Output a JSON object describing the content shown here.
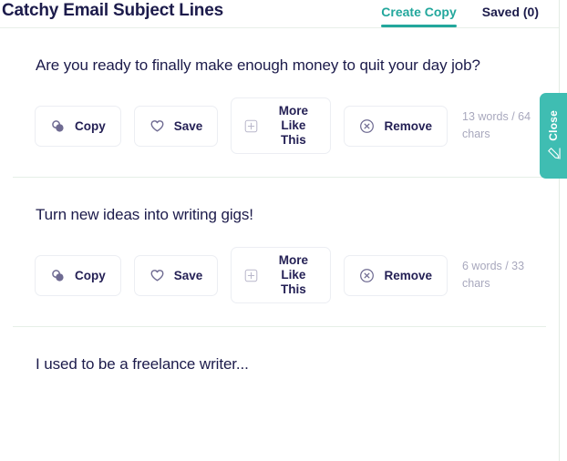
{
  "header": {
    "title": "Catchy Email Subject Lines",
    "tabs": [
      {
        "label": "Create Copy",
        "active": true
      },
      {
        "label": "Saved (0)",
        "active": false
      }
    ]
  },
  "sidebar_flap": {
    "label": "Close",
    "icon": "pencil-icon"
  },
  "actions": {
    "copy": {
      "label": "Copy",
      "icon": "copy-icon"
    },
    "save": {
      "label": "Save",
      "icon": "heart-icon"
    },
    "more_like_this": {
      "label": "More Like This",
      "icon": "plus-square-icon"
    },
    "remove": {
      "label": "Remove",
      "icon": "close-circle-icon"
    }
  },
  "results": [
    {
      "text": " Are you ready to finally make enough money to quit your day job?",
      "word_count": "13 words / 64 chars",
      "more_like_this_wrap": "narrow"
    },
    {
      "text": "Turn new ideas into writing gigs!",
      "word_count": "6 words / 33 chars",
      "more_like_this_wrap": "wide"
    },
    {
      "text": "I used to be a freelance writer...",
      "word_count": "",
      "more_like_this_wrap": "narrow"
    }
  ],
  "colors": {
    "accent_teal": "#22a79c",
    "flap_teal": "#3fbdb2",
    "text_navy": "#1c1b4b",
    "muted": "#a8a8bd",
    "border": "#eceef3",
    "divider": "#e6efe7"
  }
}
